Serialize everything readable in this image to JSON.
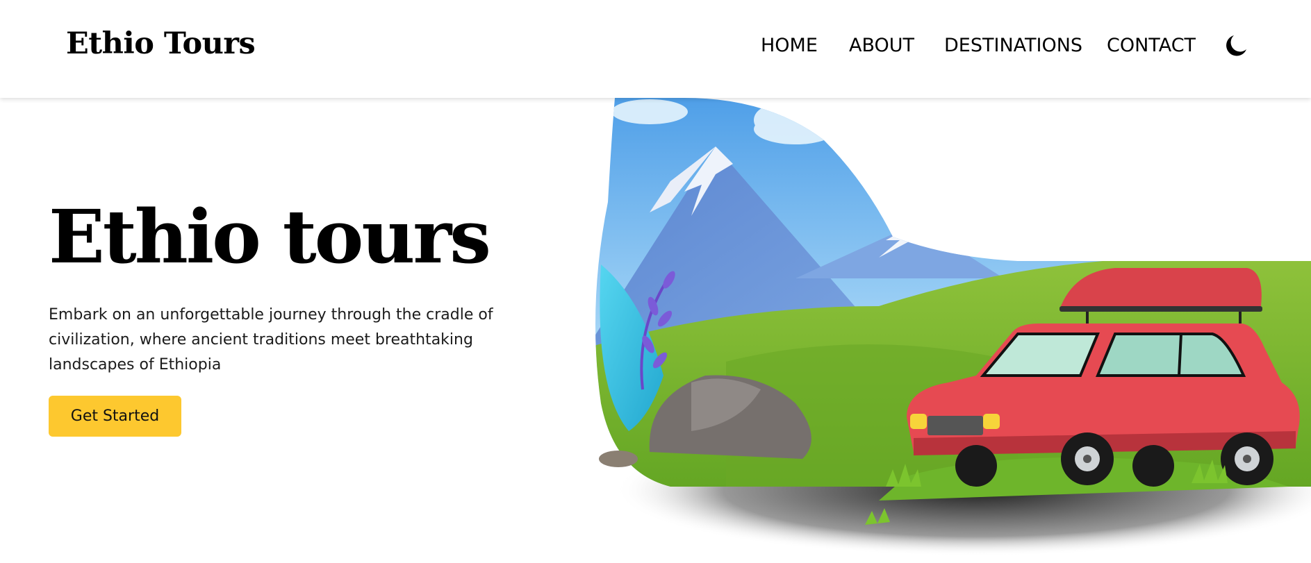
{
  "brand": {
    "name": "Ethio Tours"
  },
  "nav": {
    "items": [
      {
        "label": "HOME"
      },
      {
        "label": "ABOUT"
      },
      {
        "label": "DESTINATIONS"
      },
      {
        "label": "CONTACT"
      }
    ],
    "theme_toggle_icon": "moon-icon"
  },
  "hero": {
    "title": "Ethio tours",
    "description": "Embark on an unforgettable journey through the cradle of civilization, where ancient traditions meet breathtaking landscapes of Ethiopia",
    "cta_label": "Get Started",
    "illustration": "car-mountain-landscape-illustration"
  },
  "colors": {
    "accent": "#fdc82f",
    "text": "#000000",
    "background": "#ffffff",
    "car": "#e64a52",
    "sky": "#6fb4ea",
    "grass": "#7db82e"
  }
}
